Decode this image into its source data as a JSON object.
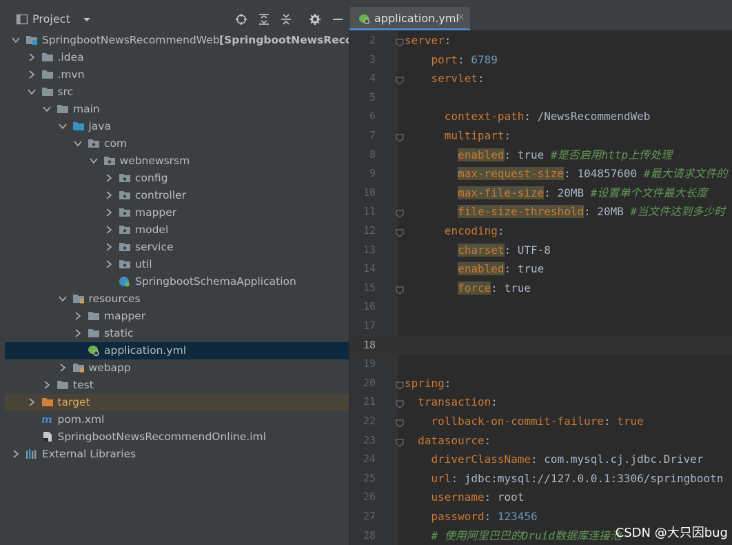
{
  "project_panel": {
    "title": "Project",
    "tree": [
      {
        "label": "SpringbootNewsRecommendWeb",
        "suffix": "[SpringbootNewsRecomm",
        "icon": "module-folder-icon",
        "expanded": true
      },
      {
        "label": ".idea",
        "icon": "folder-icon",
        "expanded": false
      },
      {
        "label": ".mvn",
        "icon": "folder-icon",
        "expanded": false
      },
      {
        "label": "src",
        "icon": "folder-icon",
        "expanded": true
      },
      {
        "label": "main",
        "icon": "folder-icon",
        "expanded": true
      },
      {
        "label": "java",
        "icon": "source-folder-icon",
        "expanded": true
      },
      {
        "label": "com",
        "icon": "package-icon",
        "expanded": true
      },
      {
        "label": "webnewsrsm",
        "icon": "package-icon",
        "expanded": true
      },
      {
        "label": "config",
        "icon": "package-icon",
        "expanded": false
      },
      {
        "label": "controller",
        "icon": "package-icon",
        "expanded": false
      },
      {
        "label": "mapper",
        "icon": "package-icon",
        "expanded": false
      },
      {
        "label": "model",
        "icon": "package-icon",
        "expanded": false
      },
      {
        "label": "service",
        "icon": "package-icon",
        "expanded": false
      },
      {
        "label": "util",
        "icon": "package-icon",
        "expanded": false
      },
      {
        "label": "SpringbootSchemaApplication",
        "icon": "spring-app-icon"
      },
      {
        "label": "resources",
        "icon": "resources-folder-icon",
        "expanded": true
      },
      {
        "label": "mapper",
        "icon": "folder-icon",
        "expanded": false
      },
      {
        "label": "static",
        "icon": "folder-icon",
        "expanded": false
      },
      {
        "label": "application.yml",
        "icon": "spring-yml-icon",
        "selected": true
      },
      {
        "label": "webapp",
        "icon": "resources-folder-icon",
        "expanded": false
      },
      {
        "label": "test",
        "icon": "folder-icon",
        "expanded": false
      },
      {
        "label": "target",
        "icon": "excluded-folder-icon",
        "expanded": false
      },
      {
        "label": "pom.xml",
        "icon": "maven-icon"
      },
      {
        "label": "SpringbootNewsRecommendOnline.iml",
        "icon": "iml-file-icon"
      },
      {
        "label": "External Libraries",
        "icon": "libraries-icon",
        "expanded": false
      }
    ]
  },
  "editor": {
    "tab_label": "application.yml",
    "tab_close": "×",
    "current_line": "18",
    "lines": [
      {
        "num": "2",
        "tokens": [
          {
            "t": "server",
            "c": "k"
          },
          {
            "t": ":",
            "c": "v"
          }
        ]
      },
      {
        "num": "3",
        "tokens": [
          {
            "t": "    "
          },
          {
            "t": "port",
            "c": "k"
          },
          {
            "t": ": ",
            "c": "v"
          },
          {
            "t": "6789",
            "c": "n"
          }
        ]
      },
      {
        "num": "4",
        "tokens": [
          {
            "t": "    "
          },
          {
            "t": "servlet",
            "c": "k"
          },
          {
            "t": ":",
            "c": "v"
          }
        ]
      },
      {
        "num": "5",
        "tokens": []
      },
      {
        "num": "6",
        "tokens": [
          {
            "t": "      "
          },
          {
            "t": "context-path",
            "c": "k"
          },
          {
            "t": ": /NewsRecommendWeb",
            "c": "v"
          }
        ]
      },
      {
        "num": "7",
        "tokens": [
          {
            "t": "      "
          },
          {
            "t": "multipart",
            "c": "k"
          },
          {
            "t": ":",
            "c": "v"
          }
        ]
      },
      {
        "num": "8",
        "tokens": [
          {
            "t": "        "
          },
          {
            "t": "enabled",
            "c": "k hl"
          },
          {
            "t": ": true ",
            "c": "v"
          },
          {
            "t": "#是否启用http上传处理",
            "c": "c"
          }
        ]
      },
      {
        "num": "9",
        "tokens": [
          {
            "t": "        "
          },
          {
            "t": "max-request-size",
            "c": "k hl"
          },
          {
            "t": ": 104857600 ",
            "c": "v"
          },
          {
            "t": "#最大请求文件的",
            "c": "c"
          }
        ]
      },
      {
        "num": "10",
        "tokens": [
          {
            "t": "        "
          },
          {
            "t": "max-file-size",
            "c": "k hl"
          },
          {
            "t": ": 20MB ",
            "c": "v"
          },
          {
            "t": "#设置单个文件最大长度",
            "c": "c"
          }
        ]
      },
      {
        "num": "11",
        "tokens": [
          {
            "t": "        "
          },
          {
            "t": "file-size-threshold",
            "c": "k hl"
          },
          {
            "t": ": 20MB ",
            "c": "v"
          },
          {
            "t": "#当文件达到多少时",
            "c": "c"
          }
        ]
      },
      {
        "num": "12",
        "tokens": [
          {
            "t": "      "
          },
          {
            "t": "encoding",
            "c": "k"
          },
          {
            "t": ":",
            "c": "v"
          }
        ]
      },
      {
        "num": "13",
        "tokens": [
          {
            "t": "        "
          },
          {
            "t": "charset",
            "c": "k hl"
          },
          {
            "t": ": UTF-8",
            "c": "v"
          }
        ]
      },
      {
        "num": "14",
        "tokens": [
          {
            "t": "        "
          },
          {
            "t": "enabled",
            "c": "k hl"
          },
          {
            "t": ": true",
            "c": "v"
          }
        ]
      },
      {
        "num": "15",
        "tokens": [
          {
            "t": "        "
          },
          {
            "t": "force",
            "c": "k hl"
          },
          {
            "t": ": true",
            "c": "v"
          }
        ]
      },
      {
        "num": "16",
        "tokens": []
      },
      {
        "num": "17",
        "tokens": []
      },
      {
        "num": "18",
        "tokens": []
      },
      {
        "num": "19",
        "tokens": []
      },
      {
        "num": "20",
        "tokens": [
          {
            "t": "spring",
            "c": "k"
          },
          {
            "t": ":",
            "c": "v"
          }
        ]
      },
      {
        "num": "21",
        "tokens": [
          {
            "t": "  "
          },
          {
            "t": "transaction",
            "c": "k"
          },
          {
            "t": ":",
            "c": "v"
          }
        ]
      },
      {
        "num": "22",
        "tokens": [
          {
            "t": "    "
          },
          {
            "t": "rollback-on-commit-failure",
            "c": "k"
          },
          {
            "t": ": ",
            "c": "v"
          },
          {
            "t": "true",
            "c": "k"
          }
        ]
      },
      {
        "num": "23",
        "tokens": [
          {
            "t": "  "
          },
          {
            "t": "datasource",
            "c": "k"
          },
          {
            "t": ":",
            "c": "v"
          }
        ]
      },
      {
        "num": "24",
        "tokens": [
          {
            "t": "    "
          },
          {
            "t": "driverClassName",
            "c": "k"
          },
          {
            "t": ": ",
            "c": "v"
          },
          {
            "t": "com.mysql.cj.jdbc.Driver",
            "c": "v"
          }
        ]
      },
      {
        "num": "25",
        "tokens": [
          {
            "t": "    "
          },
          {
            "t": "url",
            "c": "k"
          },
          {
            "t": ": jdbc:mysql://127.0.0.1:3306/springbootn",
            "c": "v"
          }
        ]
      },
      {
        "num": "26",
        "tokens": [
          {
            "t": "    "
          },
          {
            "t": "username",
            "c": "k"
          },
          {
            "t": ": root",
            "c": "v"
          }
        ]
      },
      {
        "num": "27",
        "tokens": [
          {
            "t": "    "
          },
          {
            "t": "password",
            "c": "k"
          },
          {
            "t": ": ",
            "c": "v"
          },
          {
            "t": "123456",
            "c": "n"
          }
        ]
      },
      {
        "num": "28",
        "tokens": [
          {
            "t": "    "
          },
          {
            "t": "# 使用阿里巴巴的Druid数据库连接池",
            "c": "c"
          }
        ]
      }
    ]
  },
  "watermark": "CSDN @大只因bug",
  "colors": {
    "panel_bg": "#3c3f41",
    "editor_bg": "#2b2b2b",
    "selection": "#0d293e",
    "keyword": "#cc7832",
    "number": "#6897bb",
    "comment": "#629755"
  }
}
